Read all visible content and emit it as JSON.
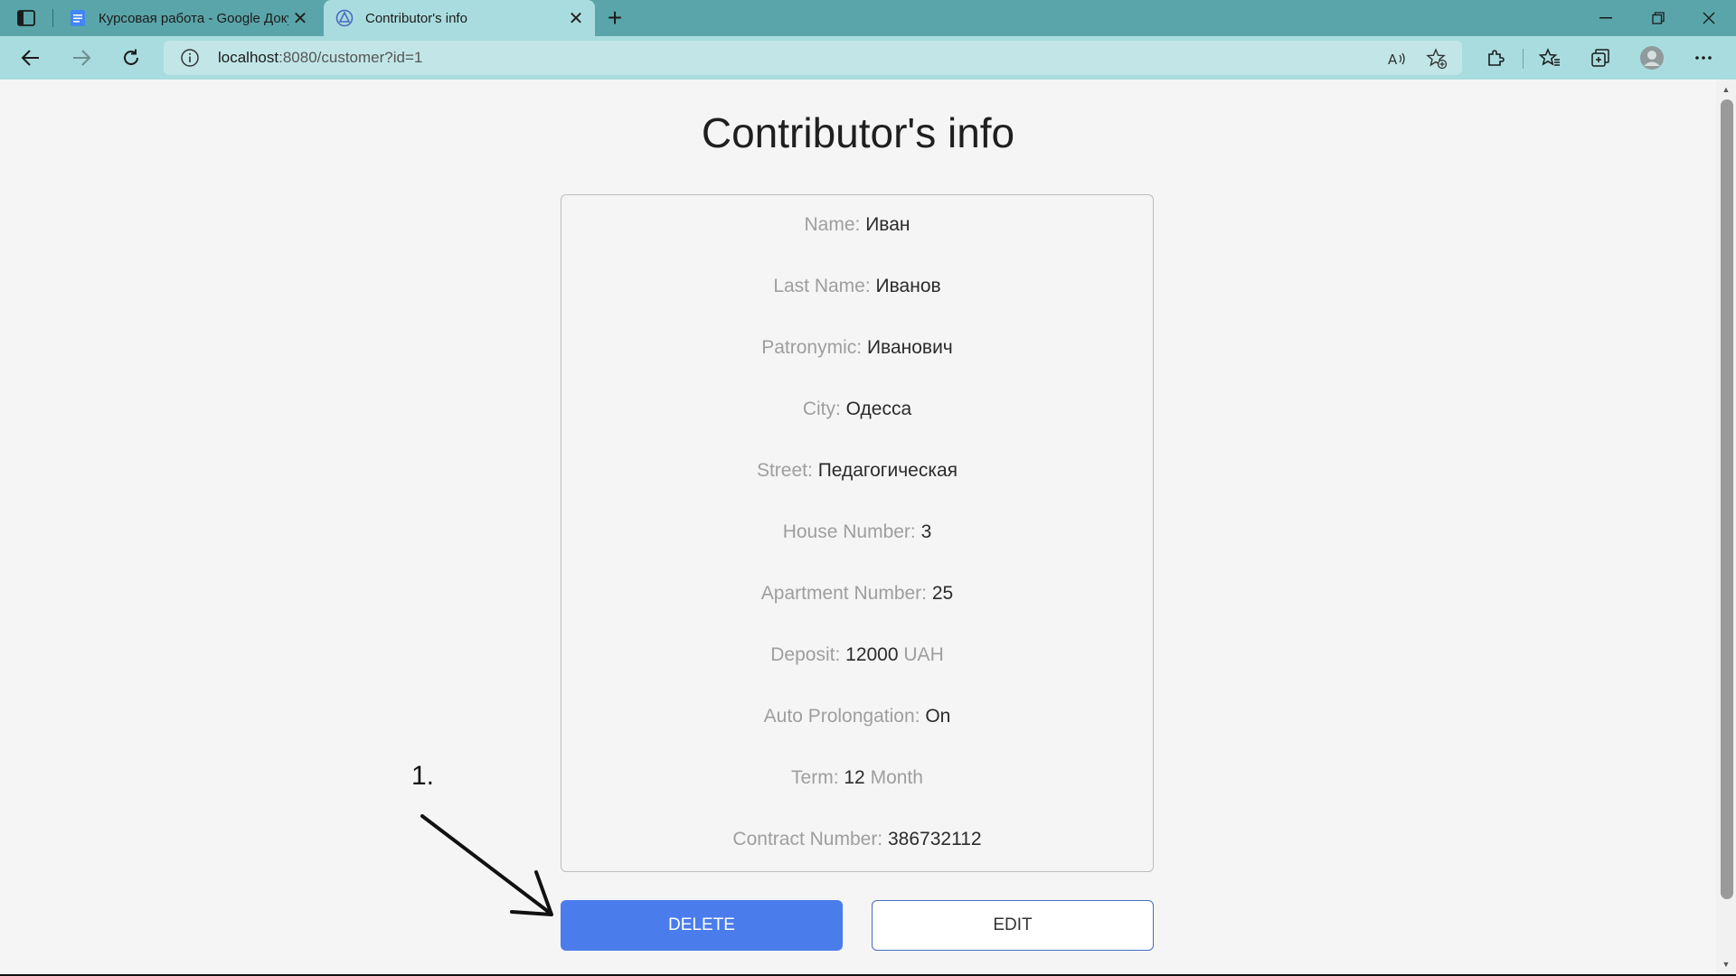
{
  "browser": {
    "tabs": [
      {
        "label": "Курсовая работа - Google Доку",
        "icon": "google-docs-icon",
        "active": false
      },
      {
        "label": "Contributor's info",
        "icon": "site-favicon-icon",
        "active": true
      }
    ],
    "address": {
      "host": "localhost",
      "rest": ":8080/customer?id=1"
    }
  },
  "page": {
    "title": "Contributor's info",
    "fields": [
      {
        "label": "Name:",
        "value": "Иван",
        "unit": ""
      },
      {
        "label": "Last Name:",
        "value": "Иванов",
        "unit": ""
      },
      {
        "label": "Patronymic:",
        "value": "Иванович",
        "unit": ""
      },
      {
        "label": "City:",
        "value": "Одесса",
        "unit": ""
      },
      {
        "label": "Street:",
        "value": "Педагогическая",
        "unit": ""
      },
      {
        "label": "House Number:",
        "value": "3",
        "unit": ""
      },
      {
        "label": "Apartment Number:",
        "value": "25",
        "unit": ""
      },
      {
        "label": "Deposit:",
        "value": "12000",
        "unit": "UAH"
      },
      {
        "label": "Auto Prolongation:",
        "value": "On",
        "unit": ""
      },
      {
        "label": "Term:",
        "value": "12",
        "unit": "Month"
      },
      {
        "label": "Contract Number:",
        "value": "386732112",
        "unit": ""
      }
    ],
    "buttons": {
      "delete": "DELETE",
      "edit": "EDIT"
    }
  },
  "annotation": {
    "text": "1."
  },
  "colors": {
    "tabbar": "#5aa5a9",
    "toolbar": "#a9dcde",
    "delete_button": "#4a7cec",
    "edit_border": "#4a6ac0"
  }
}
